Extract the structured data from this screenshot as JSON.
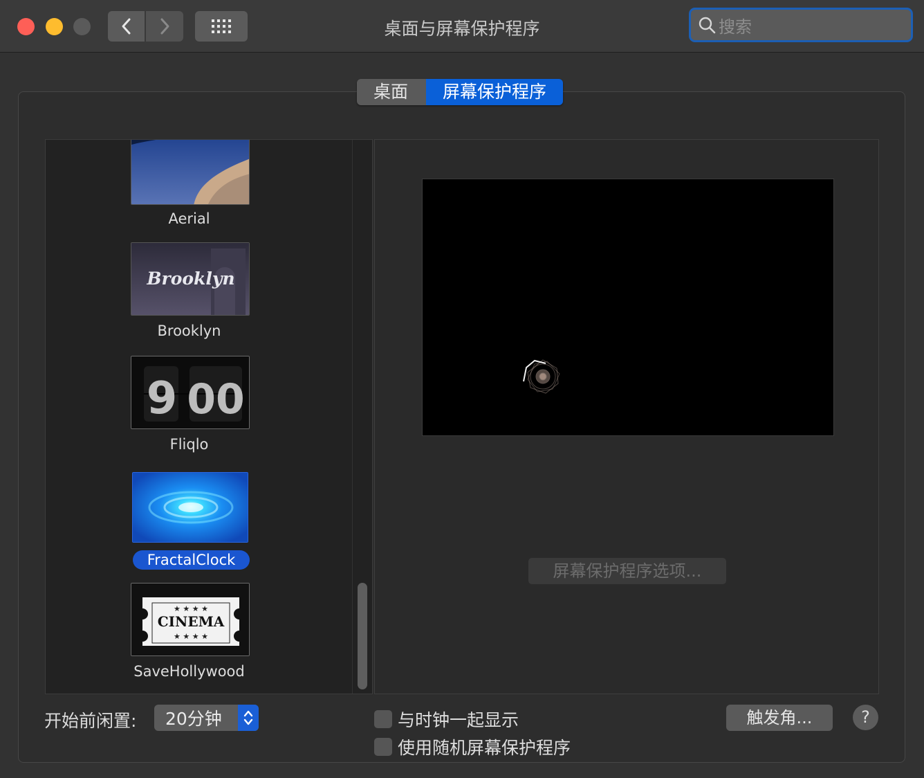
{
  "window": {
    "title": "桌面与屏幕保护程序",
    "search_placeholder": "搜索"
  },
  "tabs": [
    {
      "label": "桌面",
      "selected": false
    },
    {
      "label": "屏幕保护程序",
      "selected": true
    }
  ],
  "screensavers": [
    {
      "label": "Aerial",
      "thumb": "aerial-earth"
    },
    {
      "label": "Brooklyn",
      "thumb": "brooklyn-logo",
      "thumb_text": "Brooklyn"
    },
    {
      "label": "Fliqlo",
      "thumb": "flip-clock",
      "thumb_text": [
        "9",
        "00"
      ]
    },
    {
      "label": "FractalClock",
      "thumb": "blue-swirl",
      "selected": true
    },
    {
      "label": "SaveHollywood",
      "thumb": "cinema-ticket",
      "thumb_text": "CINEMA"
    }
  ],
  "preview": {
    "options_button": "屏幕保护程序选项..."
  },
  "bottom": {
    "idle_label": "开始前闲置:",
    "idle_value": "20分钟",
    "show_clock_label": "与时钟一起显示",
    "show_clock_checked": false,
    "random_label": "使用随机屏幕保护程序",
    "random_checked": false,
    "hot_corners_label": "触发角...",
    "help_label": "?"
  },
  "colors": {
    "accent": "#0a60d8",
    "selection": "#1a56d0",
    "close": "#fe5f57",
    "minimize": "#febc2e"
  }
}
